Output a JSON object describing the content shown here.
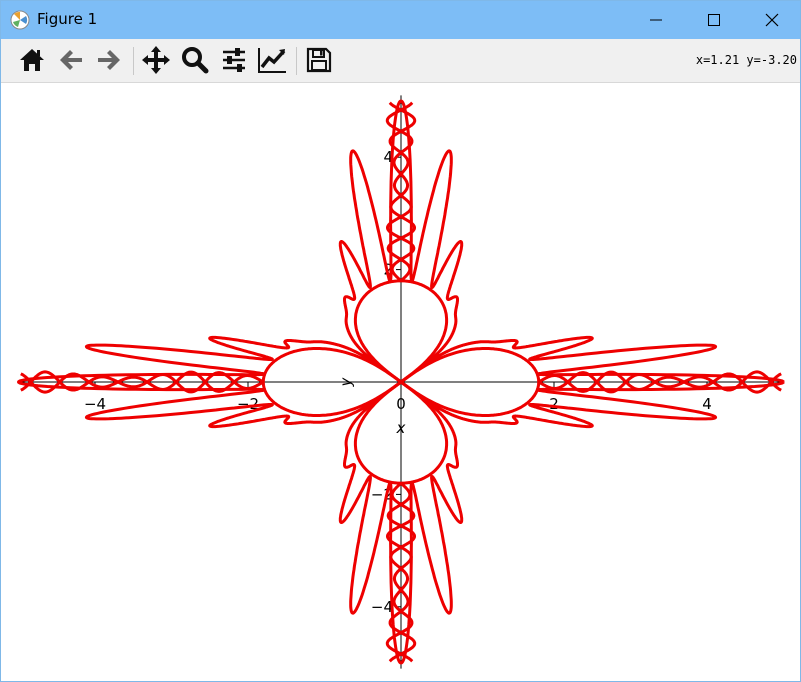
{
  "window": {
    "title": "Figure 1",
    "controls": [
      "minimize",
      "maximize",
      "close"
    ]
  },
  "toolbar": {
    "buttons": [
      {
        "name": "home",
        "icon": "home-icon"
      },
      {
        "name": "back",
        "icon": "arrow-left-icon"
      },
      {
        "name": "forward",
        "icon": "arrow-right-icon"
      },
      {
        "name": "pan",
        "icon": "move-icon"
      },
      {
        "name": "zoom",
        "icon": "magnifier-icon"
      },
      {
        "name": "configure-subplots",
        "icon": "sliders-icon"
      },
      {
        "name": "edit-axes",
        "icon": "line-chart-icon"
      },
      {
        "name": "save",
        "icon": "floppy-icon"
      }
    ],
    "coords": "x=1.21 y=-3.20"
  },
  "chart_data": {
    "type": "line",
    "title": "",
    "xlabel": "x",
    "ylabel": "y",
    "xlim": [
      -4.97,
      4.97
    ],
    "ylim": [
      -5.1,
      5.1
    ],
    "xticks": [
      -4,
      -2,
      0,
      2,
      4
    ],
    "yticks": [
      -4,
      -2,
      0,
      2,
      4
    ],
    "xtick_labels": [
      "−4",
      "−2",
      "0",
      "2",
      "4"
    ],
    "ytick_labels": [
      "−4",
      "−2",
      "0",
      "2",
      "4"
    ],
    "grid": false,
    "spines": "centered at origin",
    "series": [
      {
        "color": "#ee0000",
        "linewidth": 3,
        "curve": "polar r(t) = 5*exp(-3*cos(4t)^2) ... four-fold petal curve: inner petals out to 1.8, then braided lobes along each axis to 5",
        "x": [
          -0.0,
          1.8,
          1.7,
          1.5,
          1.2,
          0.8,
          0.4,
          0.1,
          0.0
        ],
        "y": [
          0.0,
          0.0,
          0.2,
          0.28,
          0.3,
          0.25,
          0.15,
          0.05,
          0.0
        ]
      }
    ]
  }
}
